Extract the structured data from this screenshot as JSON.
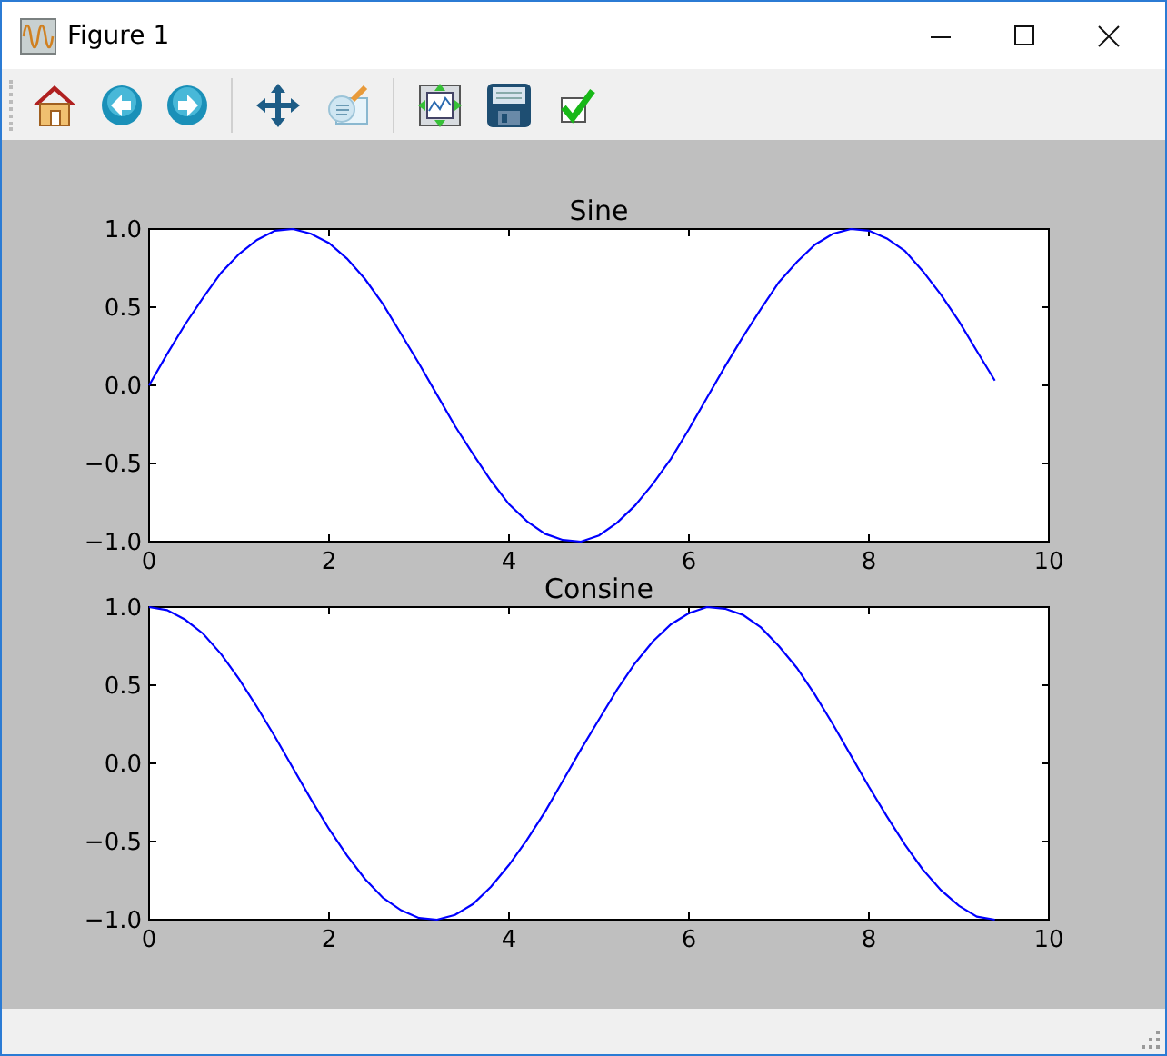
{
  "window": {
    "title": "Figure 1"
  },
  "figure": {
    "subplots": [
      {
        "chart_data": {
          "type": "line",
          "title": "Sine",
          "x": [
            0,
            0.2,
            0.4,
            0.6,
            0.8,
            1,
            1.2,
            1.4,
            1.6,
            1.8,
            2,
            2.2,
            2.4,
            2.6,
            2.8,
            3,
            3.2,
            3.4,
            3.6,
            3.8,
            4,
            4.2,
            4.4,
            4.6,
            4.8,
            5,
            5.2,
            5.4,
            5.6,
            5.8,
            6,
            6.2,
            6.4,
            6.6,
            6.8,
            7,
            7.2,
            7.4,
            7.6,
            7.8,
            8,
            8.2,
            8.4,
            8.6,
            8.8,
            9,
            9.2,
            9.4
          ],
          "series": [
            {
              "color": "#0000ff",
              "values": [
                0,
                0.2,
                0.39,
                0.56,
                0.72,
                0.84,
                0.93,
                0.99,
                1.0,
                0.97,
                0.91,
                0.81,
                0.68,
                0.52,
                0.33,
                0.14,
                -0.06,
                -0.26,
                -0.44,
                -0.61,
                -0.76,
                -0.87,
                -0.95,
                -0.99,
                -1.0,
                -0.96,
                -0.88,
                -0.77,
                -0.63,
                -0.47,
                -0.28,
                -0.08,
                0.12,
                0.31,
                0.49,
                0.66,
                0.79,
                0.9,
                0.97,
                1.0,
                0.99,
                0.94,
                0.86,
                0.73,
                0.58,
                0.41,
                0.22,
                0.03
              ]
            }
          ],
          "xlim": [
            0,
            10
          ],
          "ylim": [
            -1,
            1
          ],
          "xticks": [
            0,
            2,
            4,
            6,
            8,
            10
          ],
          "yticks": [
            {
              "value": 1,
              "label": "1.0"
            },
            {
              "value": 0.5,
              "label": "0.5"
            },
            {
              "value": 0,
              "label": "0.0"
            },
            {
              "value": -0.5,
              "label": "−0.5"
            },
            {
              "value": -1,
              "label": "−1.0"
            }
          ]
        }
      },
      {
        "chart_data": {
          "type": "line",
          "title": "Consine",
          "x": [
            0,
            0.2,
            0.4,
            0.6,
            0.8,
            1,
            1.2,
            1.4,
            1.6,
            1.8,
            2,
            2.2,
            2.4,
            2.6,
            2.8,
            3,
            3.2,
            3.4,
            3.6,
            3.8,
            4,
            4.2,
            4.4,
            4.6,
            4.8,
            5,
            5.2,
            5.4,
            5.6,
            5.8,
            6,
            6.2,
            6.4,
            6.6,
            6.8,
            7,
            7.2,
            7.4,
            7.6,
            7.8,
            8,
            8.2,
            8.4,
            8.6,
            8.8,
            9,
            9.2,
            9.4
          ],
          "series": [
            {
              "color": "#0000ff",
              "values": [
                1,
                0.98,
                0.92,
                0.83,
                0.7,
                0.54,
                0.36,
                0.17,
                -0.03,
                -0.23,
                -0.42,
                -0.59,
                -0.74,
                -0.86,
                -0.94,
                -0.99,
                -1.0,
                -0.97,
                -0.9,
                -0.79,
                -0.65,
                -0.49,
                -0.31,
                -0.11,
                0.09,
                0.28,
                0.47,
                0.64,
                0.78,
                0.89,
                0.96,
                1.0,
                0.99,
                0.95,
                0.87,
                0.75,
                0.61,
                0.44,
                0.25,
                0.05,
                -0.15,
                -0.34,
                -0.52,
                -0.68,
                -0.81,
                -0.91,
                -0.98,
                -1.0
              ]
            }
          ],
          "xlim": [
            0,
            10
          ],
          "ylim": [
            -1,
            1
          ],
          "xticks": [
            0,
            2,
            4,
            6,
            8,
            10
          ],
          "yticks": [
            {
              "value": 1,
              "label": "1.0"
            },
            {
              "value": 0.5,
              "label": "0.5"
            },
            {
              "value": 0,
              "label": "0.0"
            },
            {
              "value": -0.5,
              "label": "−0.5"
            },
            {
              "value": -1,
              "label": "−1.0"
            }
          ]
        }
      }
    ]
  }
}
